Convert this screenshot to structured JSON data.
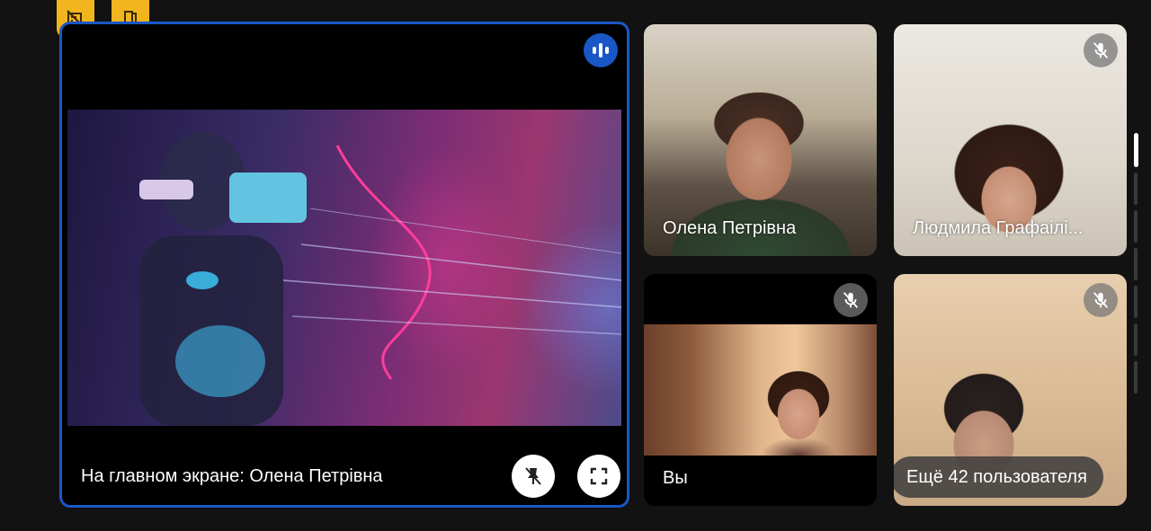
{
  "top_badges": [
    {
      "icon": "no-video-icon"
    },
    {
      "icon": "door-icon"
    }
  ],
  "main_tile": {
    "caption": "На главном экране: Олена Петрівна",
    "speaking_icon": "speaking-indicator-icon",
    "pin_icon": "unpin-icon",
    "fullscreen_icon": "fullscreen-icon"
  },
  "participants": [
    {
      "name": "Олена Петрівна",
      "muted": false
    },
    {
      "name": "Людмила Графаілі...",
      "muted": true
    },
    {
      "name": "Вы",
      "muted": true
    },
    {
      "name": "",
      "muted": true
    }
  ],
  "more_participants": "Ещё 42 пользователя",
  "colors": {
    "accent_blue": "#1a57c6",
    "badge_yellow": "#f2b51d",
    "background": "#121212"
  }
}
